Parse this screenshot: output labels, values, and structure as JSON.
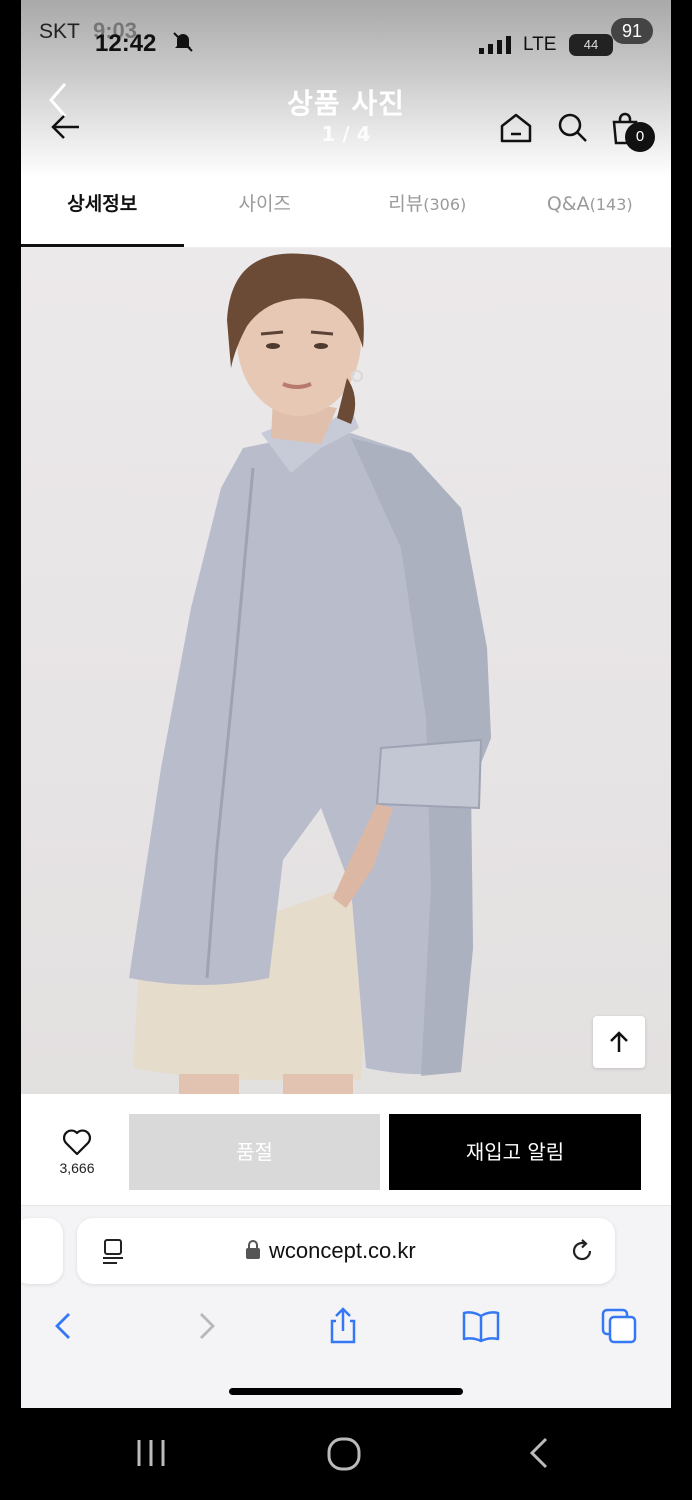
{
  "status_bar": {
    "carrier": "SKT",
    "time_ghost": "9:03",
    "time": "12:42",
    "network": "LTE",
    "battery": "44",
    "battery_ghost": "91"
  },
  "header": {
    "title": "상품 사진",
    "counter": "1 / 4",
    "cart_count": "0",
    "icons": [
      "back-arrow",
      "home",
      "search",
      "cart"
    ]
  },
  "tabs": [
    {
      "label": "상세정보",
      "count": "",
      "active": true
    },
    {
      "label": "사이즈",
      "count": "",
      "active": false
    },
    {
      "label": "리뷰",
      "count": "(306)",
      "active": false
    },
    {
      "label": "Q&A",
      "count": "(143)",
      "active": false
    }
  ],
  "action_bar": {
    "like_count": "3,666",
    "soldout_label": "품절",
    "restock_label": "재입고 알림"
  },
  "browser": {
    "url": "wconcept.co.kr"
  },
  "colors": {
    "accent": "#000000",
    "disabled": "#d9d9d9",
    "browser_icon": "#3478f6"
  }
}
